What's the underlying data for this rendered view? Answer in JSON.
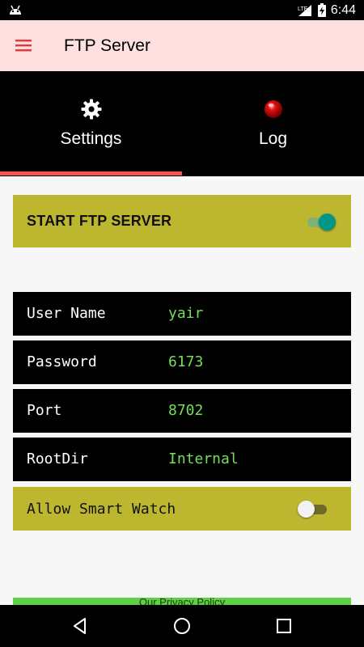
{
  "status_bar": {
    "time": "6:44",
    "network": "LTE"
  },
  "app_bar": {
    "title": "FTP Server"
  },
  "tabs": [
    {
      "label": "Settings",
      "icon": "gear-icon",
      "selected": true
    },
    {
      "label": "Log",
      "icon": "red-dot-icon",
      "selected": false
    }
  ],
  "settings": {
    "start_server": {
      "label": "START FTP SERVER",
      "on": true
    },
    "fields": [
      {
        "label": "User Name",
        "value": "yair"
      },
      {
        "label": "Password",
        "value": "6173"
      },
      {
        "label": "Port",
        "value": "8702"
      },
      {
        "label": "RootDir",
        "value": "Internal"
      }
    ],
    "smart_watch": {
      "label": "Allow Smart Watch",
      "on": false
    },
    "privacy": {
      "label": "Our Privacy Policy"
    }
  },
  "colors": {
    "app_bar_bg": "#ffe0e0",
    "accent": "#ff5252",
    "row_olive": "#bdb72f",
    "value_green": "#76dd5a",
    "switch_on": "#009688",
    "privacy_green": "#5ed046"
  }
}
